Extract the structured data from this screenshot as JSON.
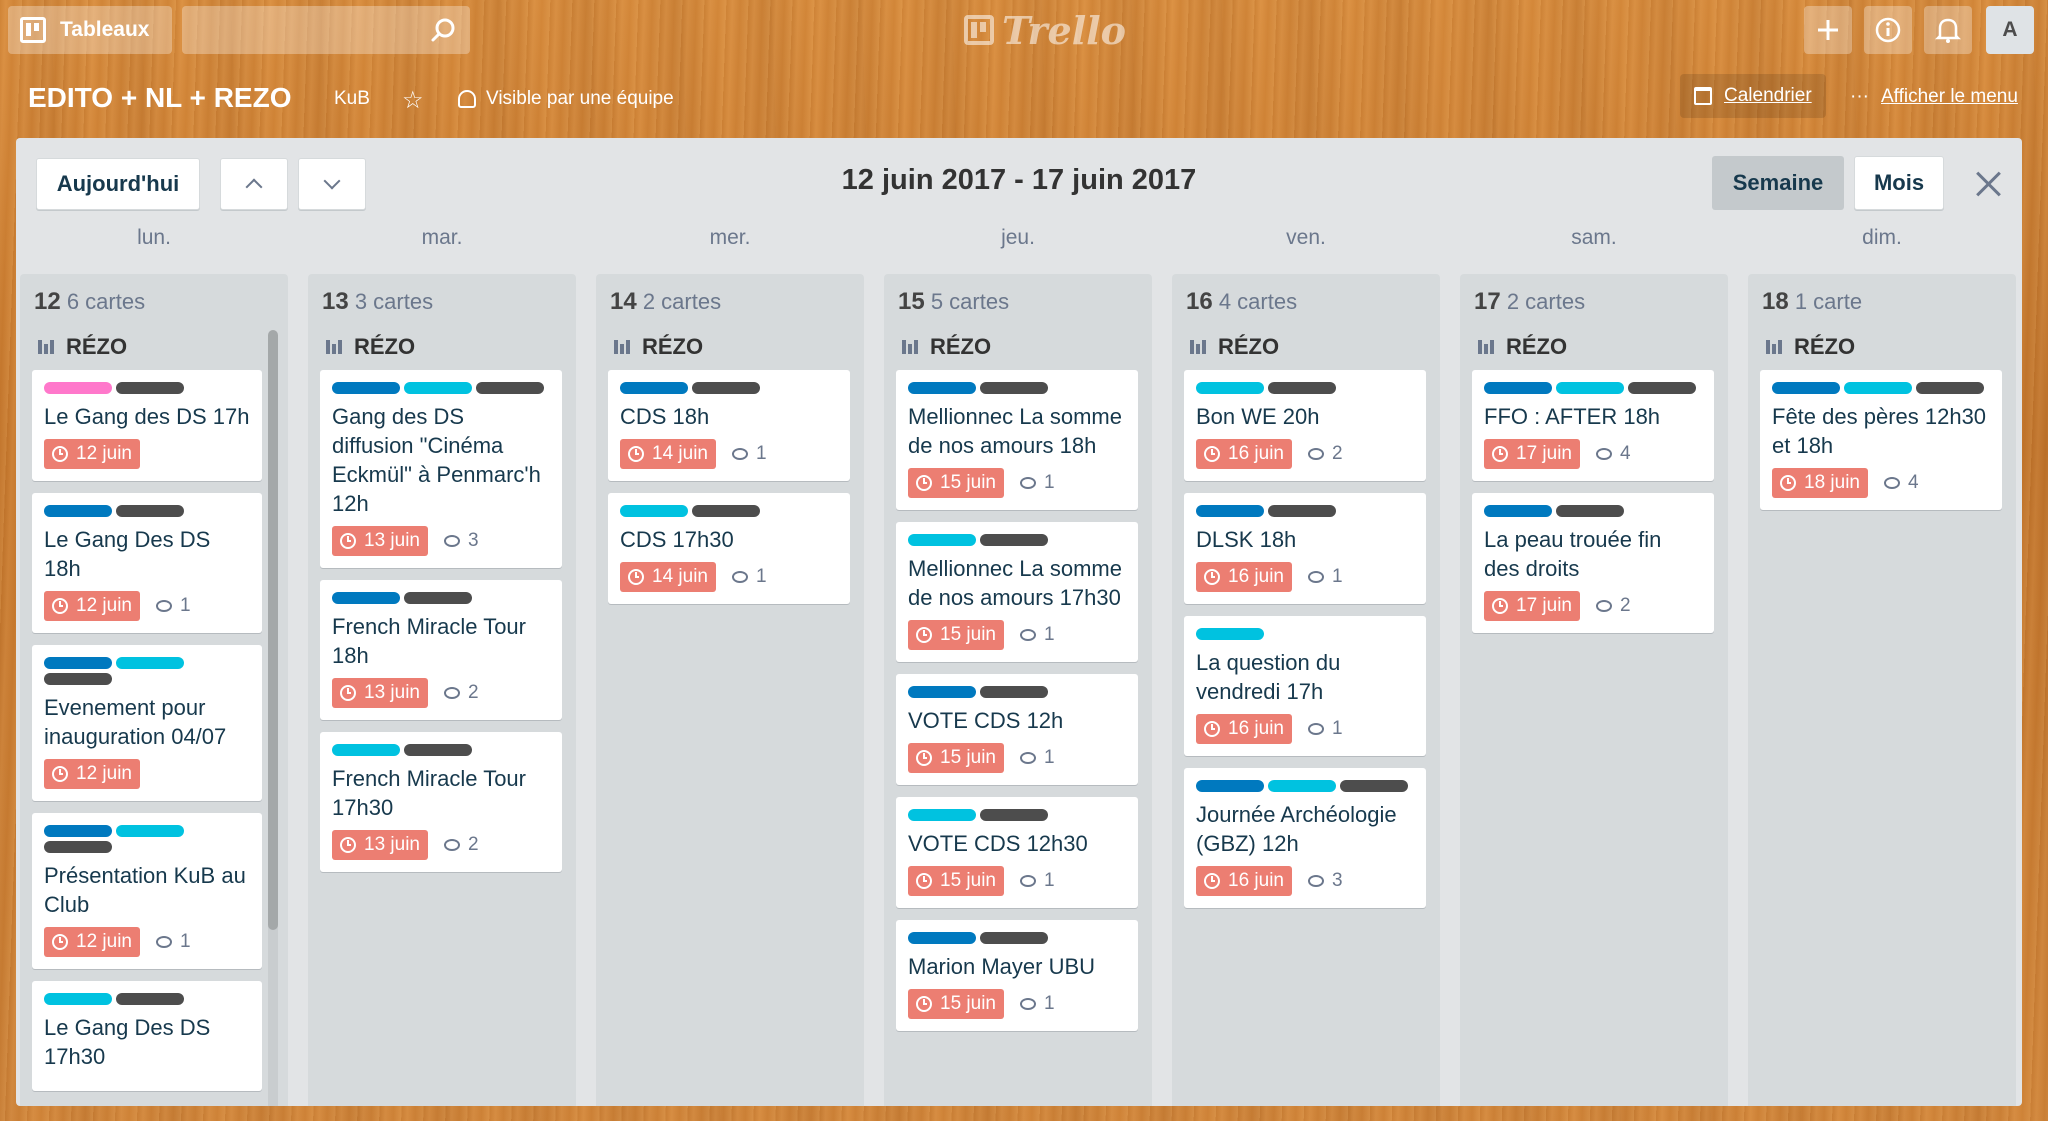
{
  "topbar": {
    "boards_label": "Tableaux",
    "search_placeholder": "",
    "logo_text": "Trello",
    "avatar_initial": "A"
  },
  "board": {
    "title": "EDITO + NL + REZO",
    "team": "KuB",
    "visibility": "Visible par une équipe",
    "calendar_label": "Calendrier",
    "menu_ellipsis": "···",
    "menu_label": "Afficher le menu"
  },
  "calendar": {
    "today_label": "Aujourd'hui",
    "range": "12 juin 2017 - 17 juin 2017",
    "week_label": "Semaine",
    "month_label": "Mois",
    "weekdays": [
      "lun.",
      "mar.",
      "mer.",
      "jeu.",
      "ven.",
      "sam.",
      "dim."
    ]
  },
  "colors": {
    "pink": "#ff78cb",
    "blue": "#0079bf",
    "sky": "#00c2e0",
    "dark": "#4d4d4d",
    "due_red": "#ec7e72"
  },
  "days": [
    {
      "num": "12",
      "count": "6 cartes",
      "list": "RÉZO",
      "cards": [
        {
          "labels": [
            "pink",
            "dark"
          ],
          "title": "Le Gang des DS 17h",
          "due": "12 juin",
          "comments": ""
        },
        {
          "labels": [
            "blue",
            "dark"
          ],
          "title": "Le Gang Des DS 18h",
          "due": "12 juin",
          "comments": "1"
        },
        {
          "labels": [
            "blue",
            "sky",
            "dark"
          ],
          "title": "Evenement pour inauguration 04/07",
          "due": "12 juin",
          "comments": ""
        },
        {
          "labels": [
            "blue",
            "sky",
            "dark"
          ],
          "title": "Présentation KuB au Club",
          "due": "12 juin",
          "comments": "1"
        },
        {
          "labels": [
            "sky",
            "dark"
          ],
          "title": "Le Gang Des DS 17h30",
          "due": "",
          "comments": ""
        }
      ]
    },
    {
      "num": "13",
      "count": "3 cartes",
      "list": "RÉZO",
      "cards": [
        {
          "labels": [
            "blue",
            "sky",
            "dark"
          ],
          "title": "Gang des DS diffusion \"Cinéma Eckmül\" à Penmarc'h 12h",
          "due": "13 juin",
          "comments": "3"
        },
        {
          "labels": [
            "blue",
            "dark"
          ],
          "title": "French Miracle Tour 18h",
          "due": "13 juin",
          "comments": "2"
        },
        {
          "labels": [
            "sky",
            "dark"
          ],
          "title": "French Miracle Tour 17h30",
          "due": "13 juin",
          "comments": "2"
        }
      ]
    },
    {
      "num": "14",
      "count": "2 cartes",
      "list": "RÉZO",
      "cards": [
        {
          "labels": [
            "blue",
            "dark"
          ],
          "title": "CDS 18h",
          "due": "14 juin",
          "comments": "1"
        },
        {
          "labels": [
            "sky",
            "dark"
          ],
          "title": "CDS 17h30",
          "due": "14 juin",
          "comments": "1"
        }
      ]
    },
    {
      "num": "15",
      "count": "5 cartes",
      "list": "RÉZO",
      "cards": [
        {
          "labels": [
            "blue",
            "dark"
          ],
          "title": "Mellionnec La somme de nos amours 18h",
          "due": "15 juin",
          "comments": "1"
        },
        {
          "labels": [
            "sky",
            "dark"
          ],
          "title": "Mellionnec La somme de nos amours 17h30",
          "due": "15 juin",
          "comments": "1"
        },
        {
          "labels": [
            "blue",
            "dark"
          ],
          "title": "VOTE CDS 12h",
          "due": "15 juin",
          "comments": "1"
        },
        {
          "labels": [
            "sky",
            "dark"
          ],
          "title": "VOTE CDS 12h30",
          "due": "15 juin",
          "comments": "1"
        },
        {
          "labels": [
            "blue",
            "dark"
          ],
          "title": "Marion Mayer UBU",
          "due": "15 juin",
          "comments": "1"
        }
      ]
    },
    {
      "num": "16",
      "count": "4 cartes",
      "list": "RÉZO",
      "cards": [
        {
          "labels": [
            "sky",
            "dark"
          ],
          "title": "Bon WE 20h",
          "due": "16 juin",
          "comments": "2"
        },
        {
          "labels": [
            "blue",
            "dark"
          ],
          "title": "DLSK 18h",
          "due": "16 juin",
          "comments": "1"
        },
        {
          "labels": [
            "sky"
          ],
          "title": "La question du vendredi 17h",
          "due": "16 juin",
          "comments": "1"
        },
        {
          "labels": [
            "blue",
            "sky",
            "dark"
          ],
          "title": "Journée Archéologie (GBZ) 12h",
          "due": "16 juin",
          "comments": "3"
        }
      ]
    },
    {
      "num": "17",
      "count": "2 cartes",
      "list": "RÉZO",
      "cards": [
        {
          "labels": [
            "blue",
            "sky",
            "dark"
          ],
          "title": "FFO : AFTER 18h",
          "due": "17 juin",
          "comments": "4"
        },
        {
          "labels": [
            "blue",
            "dark"
          ],
          "title": "La peau trouée fin des droits",
          "due": "17 juin",
          "comments": "2"
        }
      ]
    },
    {
      "num": "18",
      "count": "1 carte",
      "list": "RÉZO",
      "cards": [
        {
          "labels": [
            "blue",
            "sky",
            "dark"
          ],
          "title": "Fête des pères 12h30 et 18h",
          "due": "18 juin",
          "comments": "4"
        }
      ]
    }
  ]
}
